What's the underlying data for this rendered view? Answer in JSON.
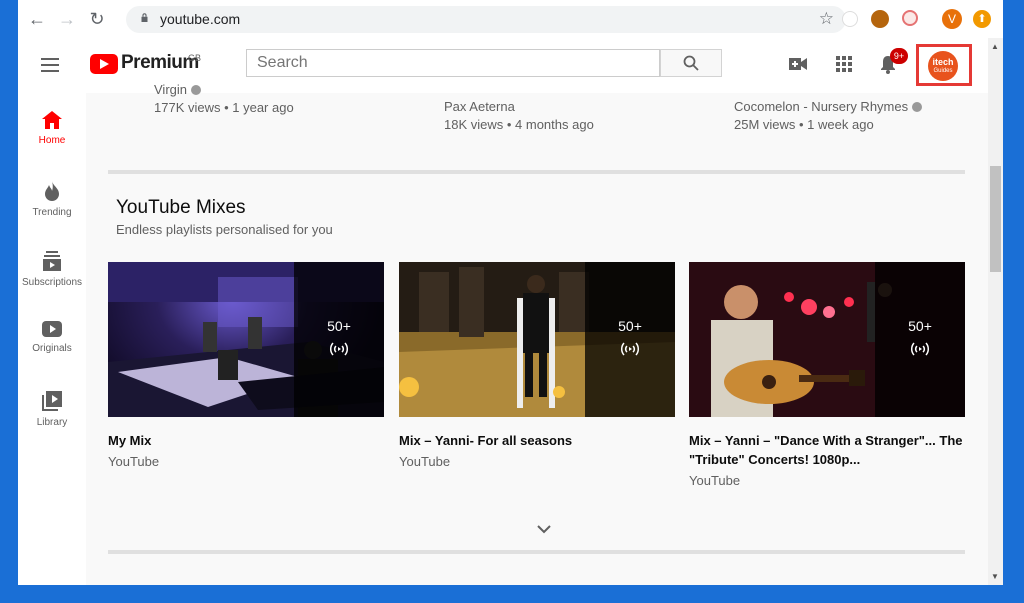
{
  "browser": {
    "url": "youtube.com",
    "profile_initial": "V"
  },
  "header": {
    "logo_text": "Premium",
    "region": "GB",
    "search_placeholder": "Search",
    "notification_count": "9+",
    "avatar_line1": "itech",
    "avatar_line2": "Guides",
    "highlight_color": "#e53935"
  },
  "sidebar": {
    "items": [
      {
        "label": "Home",
        "icon": "home-icon"
      },
      {
        "label": "Trending",
        "icon": "flame-icon"
      },
      {
        "label": "Subscriptions",
        "icon": "subscriptions-icon"
      },
      {
        "label": "Originals",
        "icon": "originals-icon"
      },
      {
        "label": "Library",
        "icon": "library-icon"
      }
    ]
  },
  "previous_row": [
    {
      "channel": "Virgin",
      "meta": "177K views • 1 year ago"
    },
    {
      "channel": "Pax Aeterna",
      "meta": "18K views • 4 months ago"
    },
    {
      "channel": "Cocomelon - Nursery Rhymes",
      "meta": "25M views • 1 week ago"
    }
  ],
  "shelf": {
    "title": "YouTube Mixes",
    "subtitle": "Endless playlists personalised for you",
    "cards": [
      {
        "title": "My Mix",
        "channel": "YouTube",
        "count": "50+"
      },
      {
        "title": "Mix – Yanni- For all seasons",
        "channel": "YouTube",
        "count": "50+"
      },
      {
        "title": "Mix – Yanni – \"Dance With a Stranger\"... The \"Tribute\" Concerts! 1080p...",
        "channel": "YouTube",
        "count": "50+"
      }
    ]
  },
  "colors": {
    "brand_red": "#ff0000",
    "desktop_blue": "#1a6fd6"
  }
}
